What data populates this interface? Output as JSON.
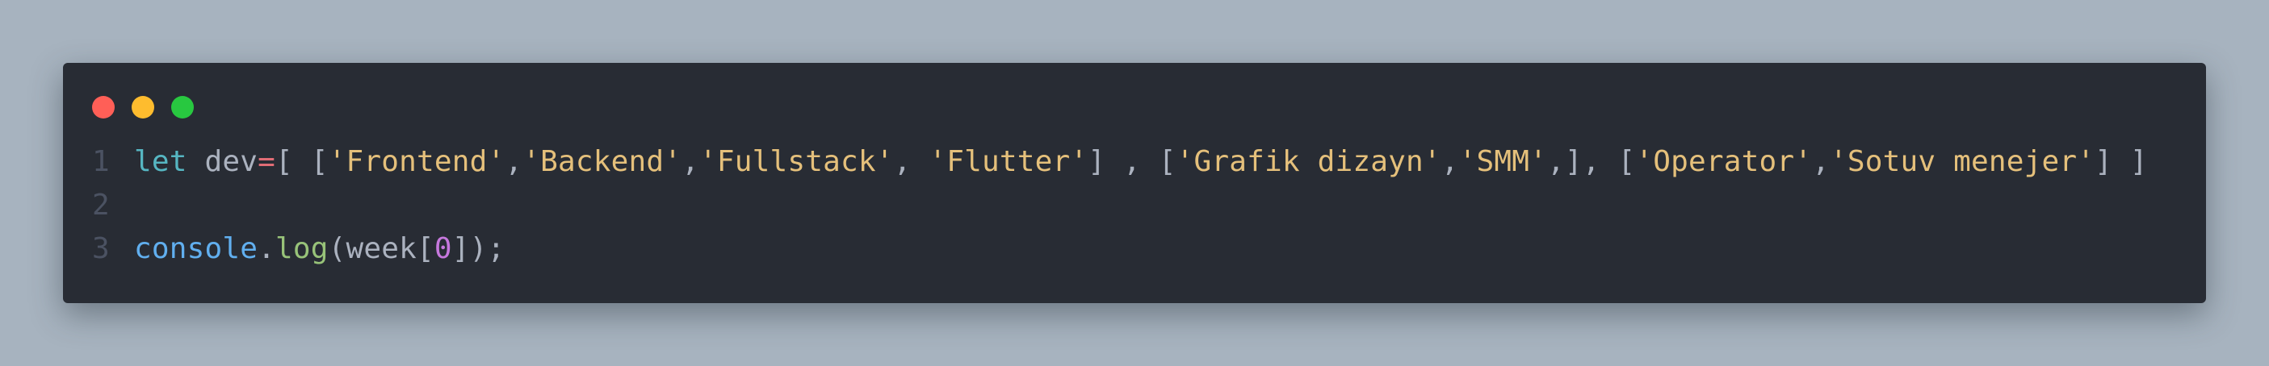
{
  "window": {
    "controls": [
      {
        "name": "close-button-dot",
        "color": "#ff5f57"
      },
      {
        "name": "minimize-button-dot",
        "color": "#febc2e"
      },
      {
        "name": "maximize-button-dot",
        "color": "#28c840"
      }
    ]
  },
  "code": {
    "lines": [
      {
        "number": "1",
        "tokens": [
          {
            "t": "let",
            "c": "kw"
          },
          {
            "t": " dev",
            "c": "plain"
          },
          {
            "t": "=",
            "c": "op"
          },
          {
            "t": "[ [",
            "c": "plain"
          },
          {
            "t": "'Frontend'",
            "c": "str"
          },
          {
            "t": ",",
            "c": "plain"
          },
          {
            "t": "'Backend'",
            "c": "str"
          },
          {
            "t": ",",
            "c": "plain"
          },
          {
            "t": "'Fullstack'",
            "c": "str"
          },
          {
            "t": ", ",
            "c": "plain"
          },
          {
            "t": "'Flutter'",
            "c": "str"
          },
          {
            "t": "] , [",
            "c": "plain"
          },
          {
            "t": "'Grafik dizayn'",
            "c": "str"
          },
          {
            "t": ",",
            "c": "plain"
          },
          {
            "t": "'SMM'",
            "c": "str"
          },
          {
            "t": ",], [",
            "c": "plain"
          },
          {
            "t": "'Operator'",
            "c": "str"
          },
          {
            "t": ",",
            "c": "plain"
          },
          {
            "t": "'Sotuv menejer'",
            "c": "str"
          },
          {
            "t": "] ]",
            "c": "plain"
          }
        ]
      },
      {
        "number": "2",
        "tokens": []
      },
      {
        "number": "3",
        "tokens": [
          {
            "t": "console",
            "c": "fn"
          },
          {
            "t": ".",
            "c": "plain"
          },
          {
            "t": "log",
            "c": "meth"
          },
          {
            "t": "(week[",
            "c": "plain"
          },
          {
            "t": "0",
            "c": "num"
          },
          {
            "t": "]);",
            "c": "plain"
          }
        ]
      }
    ]
  }
}
